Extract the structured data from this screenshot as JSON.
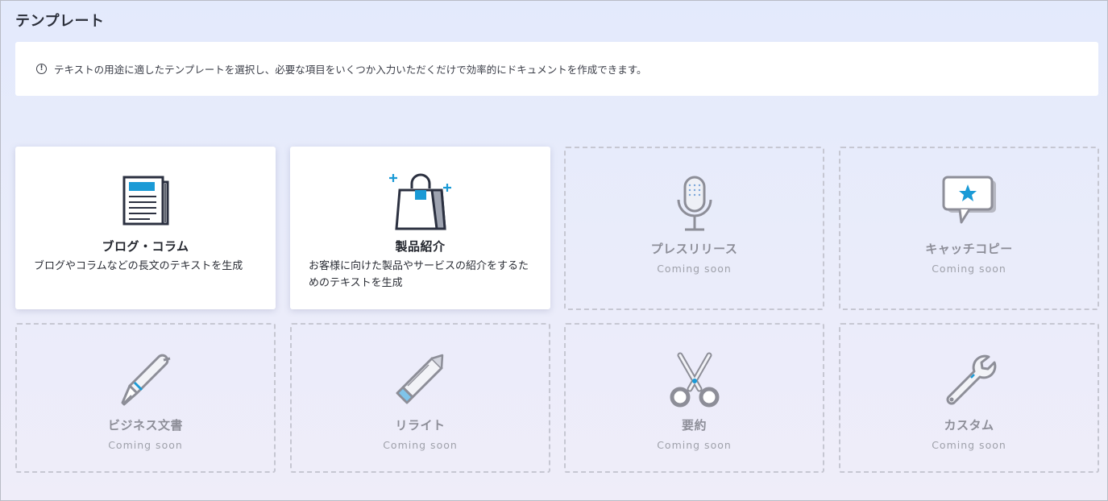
{
  "page": {
    "title": "テンプレート"
  },
  "info": {
    "text": "テキストの用途に適したテンプレートを選択し、必要な項目をいくつか入力いただくだけで効率的にドキュメントを作成できます。"
  },
  "templates": [
    {
      "title": "ブログ・コラム",
      "description": "ブログやコラムなどの長文のテキストを生成",
      "icon": "newspaper-icon"
    },
    {
      "title": "製品紹介",
      "description": "お客様に向けた製品やサービスの紹介をするためのテキストを生成",
      "icon": "shopping-bag-icon"
    },
    {
      "title": "プレスリリース",
      "status": "Coming soon",
      "icon": "microphone-icon"
    },
    {
      "title": "キャッチコピー",
      "status": "Coming soon",
      "icon": "speech-bubble-star-icon"
    },
    {
      "title": "ビジネス文書",
      "status": "Coming soon",
      "icon": "fountain-pen-icon"
    },
    {
      "title": "リライト",
      "status": "Coming soon",
      "icon": "pencil-icon"
    },
    {
      "title": "要約",
      "status": "Coming soon",
      "icon": "scissors-icon"
    },
    {
      "title": "カスタム",
      "status": "Coming soon",
      "icon": "wrench-icon"
    }
  ],
  "colors": {
    "accent": "#1a9ad6",
    "icon_dark": "#2b3040",
    "icon_muted": "#8d8e98"
  }
}
